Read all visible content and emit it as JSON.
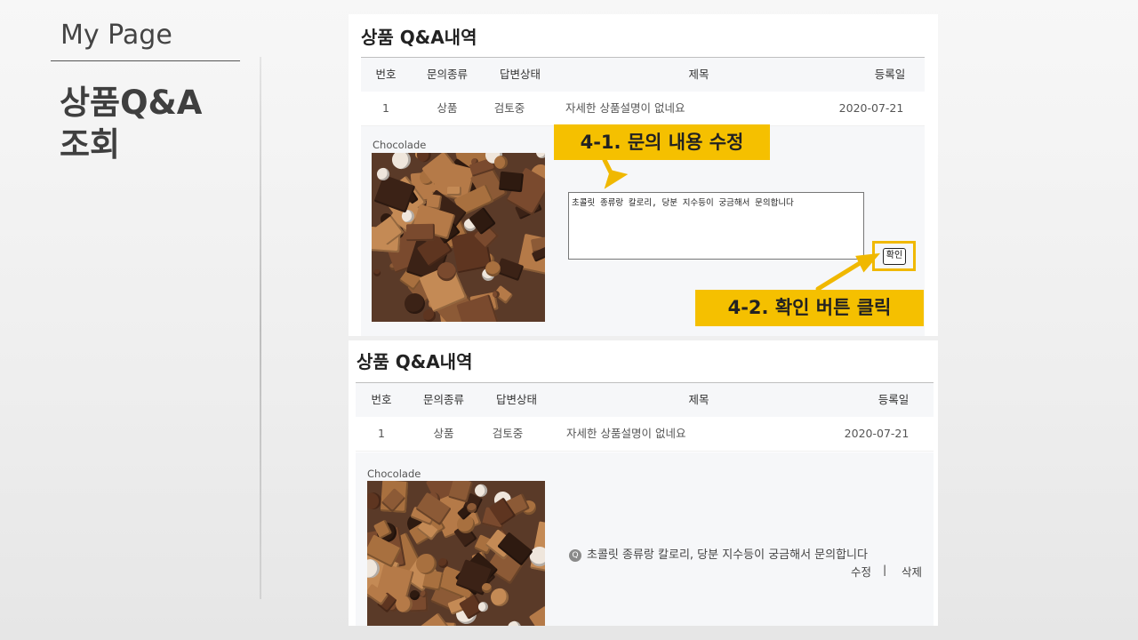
{
  "slide": {
    "subtitle": "My Page",
    "title": "상품Q&A\n조회"
  },
  "panel": {
    "title": "상품 Q&A내역",
    "columns": [
      "번호",
      "문의종류",
      "답변상태",
      "제목",
      "등록일"
    ],
    "row": {
      "no": "1",
      "type": "상품",
      "status": "검토중",
      "subject": "자세한 상품설명이 없네요",
      "date": "2020-07-21"
    },
    "product_name": "Chocolade",
    "question": "초콜릿 종류랑 칼로리, 당분 지수등이 궁금해서 문의합니다",
    "confirm_label": "확인",
    "edit_label": "수정",
    "separator": "|",
    "delete_label": "삭제",
    "q_badge": "Q"
  },
  "callouts": {
    "step1": "4-1. 문의 내용 수정",
    "step2": "4-2. 확인 버튼 클릭"
  },
  "colors": {
    "highlight": "#F5C000",
    "header_bg": "#F6F7F9"
  }
}
